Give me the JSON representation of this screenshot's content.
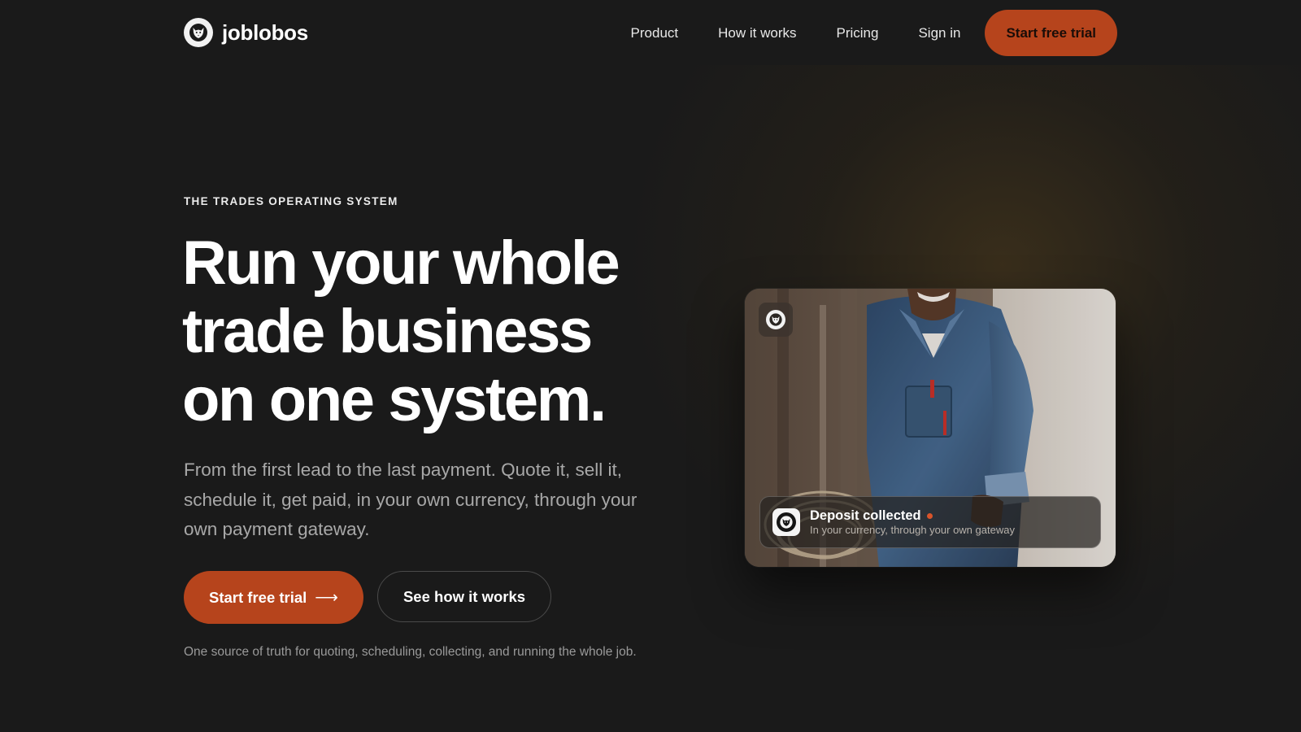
{
  "colors": {
    "background": "#1a1a1a",
    "accent": "#b6441c",
    "status_dot": "#d9542a",
    "muted_text": "#a8a8a8"
  },
  "brand": {
    "name": "joblobos",
    "logo_icon": "wolf-head-icon"
  },
  "nav": {
    "items": [
      {
        "label": "Product"
      },
      {
        "label": "How it works"
      },
      {
        "label": "Pricing"
      },
      {
        "label": "Sign in"
      }
    ],
    "cta_label": "Start free trial"
  },
  "hero": {
    "eyebrow": "THE TRADES OPERATING SYSTEM",
    "headline_lines": [
      "Run your whole",
      "trade business",
      "on one system."
    ],
    "subhead": "From the first lead to the last payment. Quote it, sell it, schedule it, get paid, in your own currency, through your own payment gateway.",
    "primary_cta": "Start free trial",
    "primary_cta_icon": "arrow-right-icon",
    "secondary_cta": "See how it works",
    "footnote": "One source of truth for quoting, scheduling, collecting, and running the whole job."
  },
  "photo_card": {
    "image_subject": "tradesperson in denim shirt",
    "badge_icon": "wolf-head-icon",
    "toast": {
      "title": "Deposit collected",
      "subtitle": "In your currency, through your own gateway",
      "icon": "wolf-head-icon",
      "status": "status-dot"
    }
  }
}
